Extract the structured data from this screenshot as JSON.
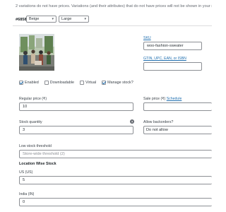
{
  "notice": "2 variations do not have prices. Variations (and their attributes) that do not have prices will not be shown in your store.",
  "variation": {
    "id": "#6858",
    "attributes": [
      {
        "selected": "Beige"
      },
      {
        "selected": "Large"
      }
    ]
  },
  "sku": {
    "label": "SKU",
    "value": "woo-fashion-sweater"
  },
  "gtin": {
    "label": "GTIN, UPC, EAN, or ISBN",
    "value": ""
  },
  "checkboxes": [
    {
      "label": "Enabled",
      "checked": true
    },
    {
      "label": "Downloadable",
      "checked": false
    },
    {
      "label": "Virtual",
      "checked": false
    },
    {
      "label": "Manage stock?",
      "checked": true
    }
  ],
  "regular_price": {
    "label": "Regular price (₹)",
    "value": "10"
  },
  "sale_price": {
    "label": "Sale price (₹)",
    "link": "Schedule",
    "value": ""
  },
  "stock_quantity": {
    "label": "Stock quantity",
    "value": "3",
    "help_icon": "question-icon"
  },
  "backorders": {
    "label": "Allow backorders?",
    "selected": "Do not allow"
  },
  "low_stock": {
    "label": "Low stock threshold",
    "placeholder": "Store-wide threshold (2)"
  },
  "location_stock": {
    "title": "Location Wise Stock",
    "locations": [
      {
        "label": "US (US)",
        "value": "5"
      },
      {
        "label": "India (IN)",
        "value": "0"
      }
    ]
  },
  "colors": {
    "accent": "#2271b1",
    "border": "#8c8f94",
    "text": "#3c434a"
  }
}
